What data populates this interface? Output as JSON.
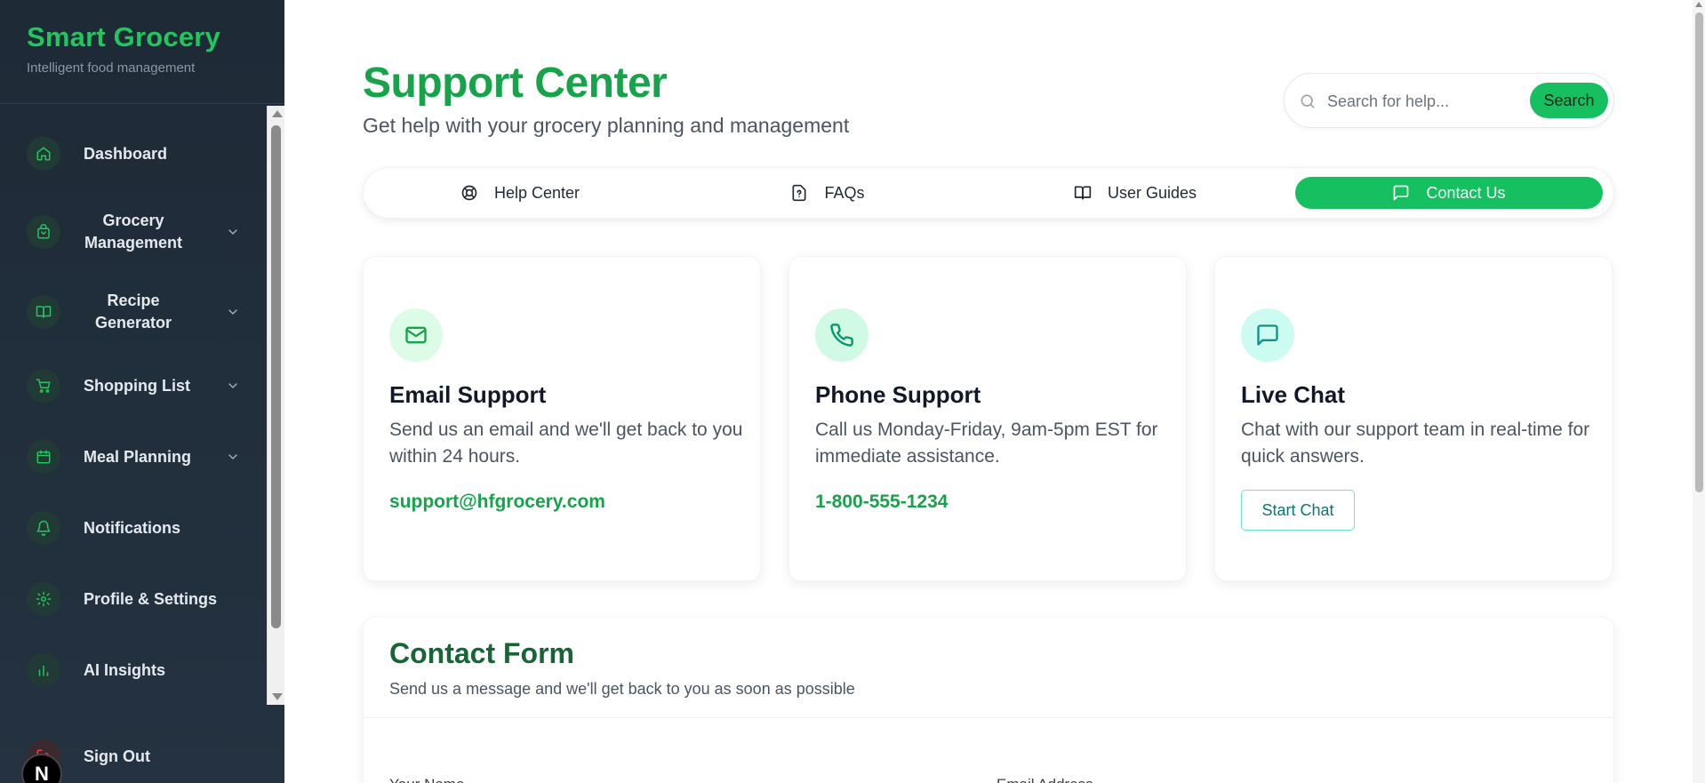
{
  "brand": {
    "title": "Smart Grocery",
    "subtitle": "Intelligent food management"
  },
  "sidebar": {
    "items": [
      {
        "label": "Dashboard",
        "icon": "home-icon",
        "expandable": false
      },
      {
        "label": "Grocery Management",
        "icon": "bag-icon",
        "expandable": true
      },
      {
        "label": "Recipe Generator",
        "icon": "book-icon",
        "expandable": true
      },
      {
        "label": "Shopping List",
        "icon": "cart-icon",
        "expandable": true
      },
      {
        "label": "Meal Planning",
        "icon": "calendar-icon",
        "expandable": true
      },
      {
        "label": "Notifications",
        "icon": "bell-icon",
        "expandable": false
      },
      {
        "label": "Profile & Settings",
        "icon": "gear-icon",
        "expandable": false
      },
      {
        "label": "AI Insights",
        "icon": "bar-chart-icon",
        "expandable": false
      }
    ],
    "signout_label": "Sign Out",
    "badge_letter": "N"
  },
  "header": {
    "title": "Support Center",
    "subtitle": "Get help with your grocery planning and management"
  },
  "search": {
    "placeholder": "Search for help...",
    "value": "",
    "button_label": "Search"
  },
  "tabs": [
    {
      "label": "Help Center",
      "icon": "lifebuoy-icon",
      "active": false
    },
    {
      "label": "FAQs",
      "icon": "file-question-icon",
      "active": false
    },
    {
      "label": "User Guides",
      "icon": "book-open-icon",
      "active": false
    },
    {
      "label": "Contact Us",
      "icon": "message-icon",
      "active": true
    }
  ],
  "cards": [
    {
      "title": "Email Support",
      "description": "Send us an email and we'll get back to you within 24 hours.",
      "link": "support@hfgrocery.com",
      "icon": "mail-icon",
      "icon_bg": "#dcfce7",
      "icon_color": "#16a34a"
    },
    {
      "title": "Phone Support",
      "description": "Call us Monday-Friday, 9am-5pm EST for immediate assistance.",
      "link": "1-800-555-1234",
      "icon": "phone-icon",
      "icon_bg": "#d1fae5",
      "icon_color": "#059669"
    },
    {
      "title": "Live Chat",
      "description": "Chat with our support team in real-time for quick answers.",
      "button_label": "Start Chat",
      "icon": "chat-icon",
      "icon_bg": "#ccfbf1",
      "icon_color": "#0d9488"
    }
  ],
  "contact_form": {
    "title": "Contact Form",
    "subtitle": "Send us a message and we'll get back to you as soon as possible",
    "name_label": "Your Name",
    "email_label": "Email Address"
  },
  "colors": {
    "accent": "#16c060",
    "title_green": "#16a34a",
    "sidebar_bg": "#1e2a36"
  }
}
